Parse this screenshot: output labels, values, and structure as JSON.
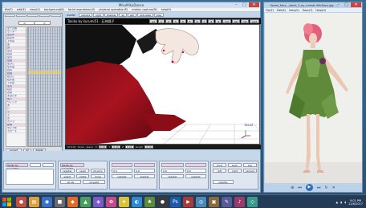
{
  "mmd": {
    "title": "MikuMikuDance",
    "menu": [
      "file(F)",
      "edit(E)",
      "view(V)",
      "background(B)",
      "facial expression(X)",
      "physical operation(P)",
      "motion capture(M)",
      "help(H)"
    ],
    "frame": {
      "left": "<",
      "value": "0",
      "right": ">"
    },
    "tracks": [
      "全ての親",
      "センター",
      "左足IK",
      "右足IK",
      "上半身",
      "首",
      "頭",
      "左目",
      "右目",
      "左肩",
      "左腕",
      "左ひじ",
      "左手首",
      "右肩",
      "右腕",
      "右ひじ",
      "右手首",
      "下半身",
      "左足",
      "右足",
      "表情",
      "まばたき",
      "笑い",
      "ウィンク",
      "あ",
      "い",
      "う",
      "え",
      "お",
      "カメラ",
      "照明",
      "セルフ影",
      "スカート"
    ],
    "left_bottom": [
      "current",
      "all",
      "delete",
      "copy",
      "paste",
      "reverse"
    ],
    "vp_toolbar_label": "model",
    "vp_toolbar": [
      "camera",
      "light",
      "shadow",
      "sp",
      "sph",
      "anti-alias",
      "play"
    ],
    "model_name": "Tokiko by kurumi51 · 石神鴇子",
    "vp_tabs": [
      "ed",
      "1",
      "2",
      "3",
      "4",
      "5",
      "6",
      "7",
      "8",
      "9",
      "ind",
      "sel",
      "rot",
      "ped"
    ],
    "local_label": "local",
    "status": [
      "[0:0:0]",
      "bone",
      "piece",
      "X",
      "0.00",
      "Y",
      "0.00",
      "Z",
      "0.00",
      "length",
      "0.00"
    ],
    "bottom": {
      "model_label": "Tokiko by kurumi51",
      "btns1": [
        "register",
        "reset",
        "physics",
        "select",
        "rotate",
        "move",
        "all sel",
        "unregist"
      ],
      "btns2": [
        "front",
        "back",
        "top",
        "left",
        "right",
        "camera",
        "register"
      ],
      "fields": [
        "0.0",
        "0.0",
        "0.0",
        "0.0"
      ]
    }
  },
  "viewer": {
    "title": "forest_fairy__stock_3_by_mimdi-d9x3dpu.jpg - ...",
    "menu": [
      "File(F)",
      "Edit(E)",
      "View(V)",
      "Tools(T)",
      "Help(H)"
    ],
    "controls": [
      "prev",
      "zoom",
      "play",
      "rotate",
      "next"
    ]
  },
  "taskbar": {
    "time": "9:01 PM",
    "date": "12/6/2017"
  },
  "colors": {
    "desktop": "#2c5f86",
    "window_frame": "#bfd6ec",
    "dress_red": "#a8131f",
    "viewport_bg": "#ffffff",
    "taskbar": "#243b57"
  }
}
